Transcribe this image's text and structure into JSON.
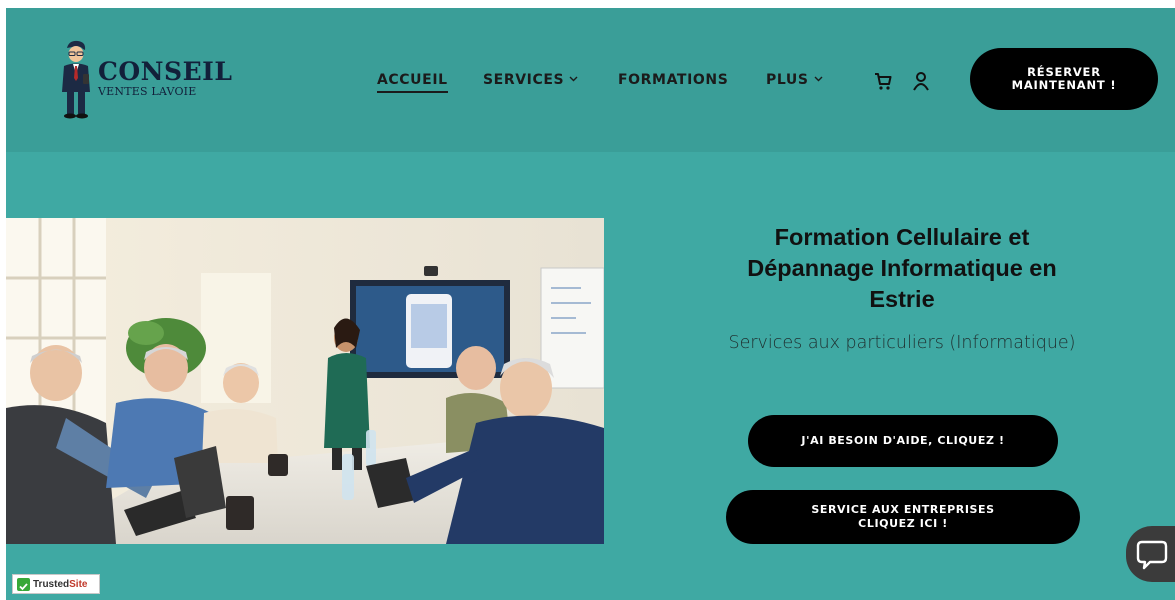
{
  "header": {
    "logo": {
      "title": "CONSEIL",
      "subtitle": "VENTES LAVOIE"
    },
    "nav": {
      "items": [
        {
          "label": "ACCUEIL",
          "active": true,
          "has_dropdown": false
        },
        {
          "label": "SERVICES",
          "active": false,
          "has_dropdown": true
        },
        {
          "label": "FORMATIONS",
          "active": false,
          "has_dropdown": false
        },
        {
          "label": "PLUS",
          "active": false,
          "has_dropdown": true
        }
      ]
    },
    "icons": [
      "cart-icon",
      "user-icon"
    ],
    "cta_label": "RÉSERVER MAINTENANT !"
  },
  "hero": {
    "title": "Formation Cellulaire et Dépannage Informatique en Estrie",
    "subtitle": "Services aux particuliers (Informatique)",
    "buttons": {
      "help_label": "J'AI BESOIN D'AIDE, CLIQUEZ !",
      "business_label": "SERVICE AUX ENTREPRISES CLIQUEZ ICI !"
    }
  },
  "badge": {
    "prefix": "Trusted",
    "suffix": "Site"
  },
  "colors": {
    "page_bg": "#3fa9a3",
    "header_bg": "#3a9e98",
    "button_bg": "#000000",
    "button_text": "#ffffff",
    "logo_navy": "#12203a"
  }
}
